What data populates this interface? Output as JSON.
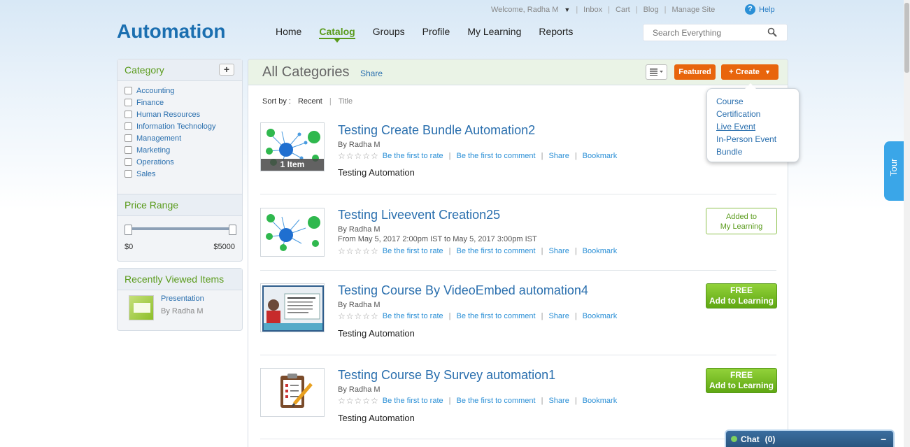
{
  "header": {
    "welcome": "Welcome, Radha M",
    "links": [
      "Inbox",
      "Cart",
      "Blog",
      "Manage Site"
    ],
    "help": "Help",
    "logo": "Automation",
    "nav": [
      "Home",
      "Catalog",
      "Groups",
      "Profile",
      "My Learning",
      "Reports"
    ],
    "search_placeholder": "Search Everything"
  },
  "sidebar": {
    "category_title": "Category",
    "categories": [
      "Accounting",
      "Finance",
      "Human Resources",
      "Information Technology",
      "Management",
      "Marketing",
      "Operations",
      "Sales"
    ],
    "price_title": "Price Range",
    "price_min": "$0",
    "price_max": "$5000",
    "recent_title": "Recently Viewed Items",
    "recent_item": {
      "title": "Presentation",
      "by": "By Radha M"
    }
  },
  "main": {
    "title": "All Categories",
    "share": "Share",
    "featured": "Featured",
    "create": "+ Create",
    "sort_label": "Sort by :",
    "sort_recent": "Recent",
    "sort_title": "Title",
    "rate_link": "Be the first to rate",
    "comment_link": "Be the first to comment",
    "share_link": "Share",
    "bookmark_link": "Bookmark",
    "items": [
      {
        "title": "Testing Create Bundle Automation2",
        "by": "By Radha M",
        "desc": "Testing Automation",
        "badge": "1 Item"
      },
      {
        "title": "Testing Liveevent Creation25",
        "by": "By Radha M",
        "meta": "From May 5, 2017 2:00pm IST to May 5, 2017 3:00pm IST",
        "button_line1": "Added to",
        "button_line2": "My Learning"
      },
      {
        "title": "Testing Course By VideoEmbed automation4",
        "by": "By Radha M",
        "desc": "Testing Automation",
        "button_line1": "FREE",
        "button_line2": "Add to Learning"
      },
      {
        "title": "Testing Course By Survey automation1",
        "by": "By Radha M",
        "desc": "Testing Automation",
        "button_line1": "FREE",
        "button_line2": "Add to Learning"
      }
    ]
  },
  "create_menu": [
    "Course",
    "Certification",
    "Live Event",
    "In-Person Event",
    "Bundle"
  ],
  "tour": "Tour",
  "chat": {
    "label": "Chat",
    "count": "(0)"
  }
}
